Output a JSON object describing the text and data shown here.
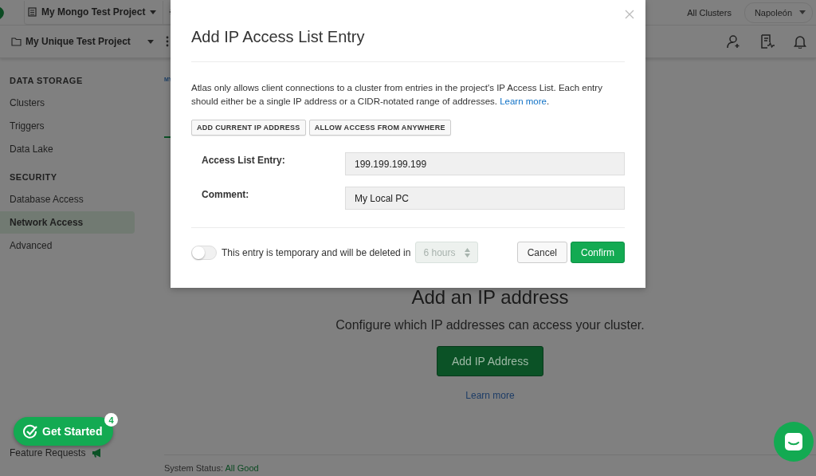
{
  "top_bar": {
    "project_selector": "My Mongo Test Project",
    "all_clusters": "All Clusters",
    "user_menu": "Napoleón"
  },
  "project_bar": {
    "project": "My Unique Test Project"
  },
  "sidebar": {
    "sections": [
      {
        "title": "DATA STORAGE",
        "items": [
          {
            "label": "Clusters",
            "selected": false
          },
          {
            "label": "Triggers",
            "selected": false
          },
          {
            "label": "Data Lake",
            "selected": false
          }
        ]
      },
      {
        "title": "SECURITY",
        "items": [
          {
            "label": "Database Access",
            "selected": false
          },
          {
            "label": "Network Access",
            "selected": true
          },
          {
            "label": "Advanced",
            "selected": false
          }
        ]
      }
    ],
    "get_started": {
      "label": "Get Started",
      "badge": "4"
    },
    "feature_requests": "Feature Requests"
  },
  "main": {
    "breadcrumb": "MY",
    "empty_state": {
      "title": "Add an IP address",
      "text": "Configure which IP addresses can access your cluster.",
      "button": "Add IP Address",
      "link": "Learn more"
    },
    "status": {
      "label": "System Status:",
      "value": "All Good"
    }
  },
  "modal": {
    "title": "Add IP Access List Entry",
    "description": "Atlas only allows client connections to a cluster from entries in the project's IP Access List. Each entry should either be a single IP address or a CIDR-notated range of addresses.",
    "link": "Learn more",
    "after_link": ".",
    "quick_buttons": [
      "ADD CURRENT IP ADDRESS",
      "ALLOW ACCESS FROM ANYWHERE"
    ],
    "fields": [
      {
        "label": "Access List Entry:",
        "value": "199.199.199.199"
      },
      {
        "label": "Comment:",
        "value": "My Local PC"
      }
    ],
    "temporary": {
      "on": false,
      "label": "This entry is temporary and will be deleted in",
      "duration": "6 hours",
      "disabled": true
    },
    "buttons": [
      {
        "label": "Cancel",
        "kind": "secondary"
      },
      {
        "label": "Confirm",
        "kind": "primary"
      }
    ]
  }
}
